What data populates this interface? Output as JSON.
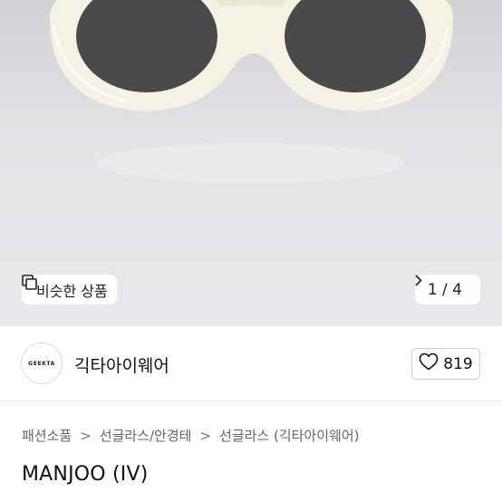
{
  "gallery": {
    "similar_label": "비슷한 상품",
    "counter": "1 / 4",
    "icons": {
      "similar": "copy-squares-icon",
      "next": "chevron-right-icon"
    }
  },
  "seller": {
    "avatar_text": "GEEKTA",
    "name": "긱타아이웨어",
    "like_count": "819",
    "like_icon": "heart-outline-icon"
  },
  "breadcrumb": [
    "패션소품",
    "선글라스/안경테",
    "선글라스 (긱타아이웨어)"
  ],
  "product": {
    "title": "MANJOO (IV)"
  },
  "colors": {
    "frame": "#f5f1e4",
    "lens": "#4a4a4c",
    "background": "#e4e4e7"
  }
}
